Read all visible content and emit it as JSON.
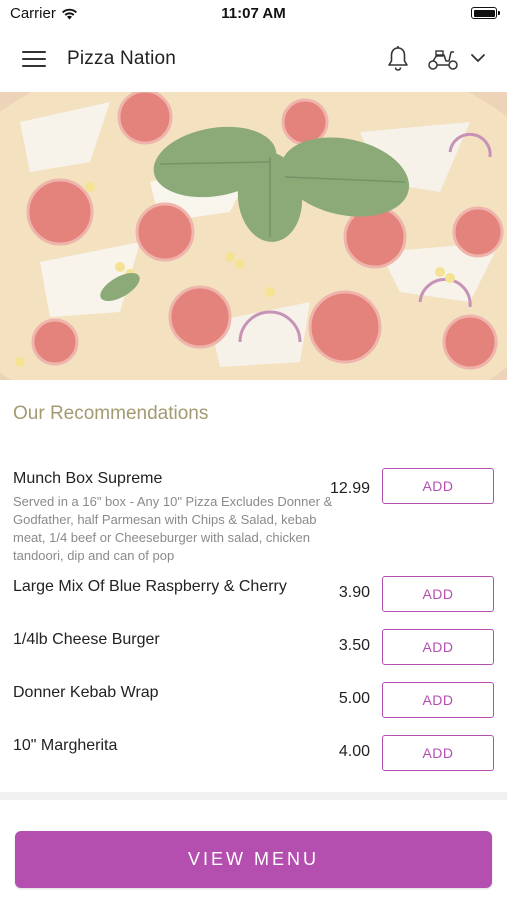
{
  "status_bar": {
    "carrier": "Carrier",
    "time": "11:07 AM"
  },
  "header": {
    "title": "Pizza Nation",
    "icons": [
      "hamburger-menu-icon",
      "bell-icon",
      "scooter-icon",
      "chevron-down-icon"
    ]
  },
  "recommendations": {
    "title": "Our Recommendations",
    "items": [
      {
        "name": "Munch Box Supreme",
        "description": "Served in a 16\" box - Any 10\" Pizza Excludes Donner & Godfather, half Parmesan with Chips & Salad, kebab meat, 1/4 beef or Cheeseburger with salad, chicken tandoori, dip and can of pop",
        "price": "12.99",
        "button_label": "ADD"
      },
      {
        "name": "Large Mix Of Blue Raspberry & Cherry",
        "description": "",
        "price": "3.90",
        "button_label": "ADD"
      },
      {
        "name": "1/4lb Cheese Burger",
        "description": "",
        "price": "3.50",
        "button_label": "ADD"
      },
      {
        "name": "Donner Kebab Wrap",
        "description": "",
        "price": "5.00",
        "button_label": "ADD"
      },
      {
        "name": "10\" Margherita",
        "description": "",
        "price": "4.00",
        "button_label": "ADD"
      }
    ]
  },
  "footer": {
    "view_menu_label": "VIEW MENU"
  },
  "colors": {
    "accent": "#b44fb0",
    "section_title": "#a39a72",
    "description": "#8a8a8a"
  }
}
